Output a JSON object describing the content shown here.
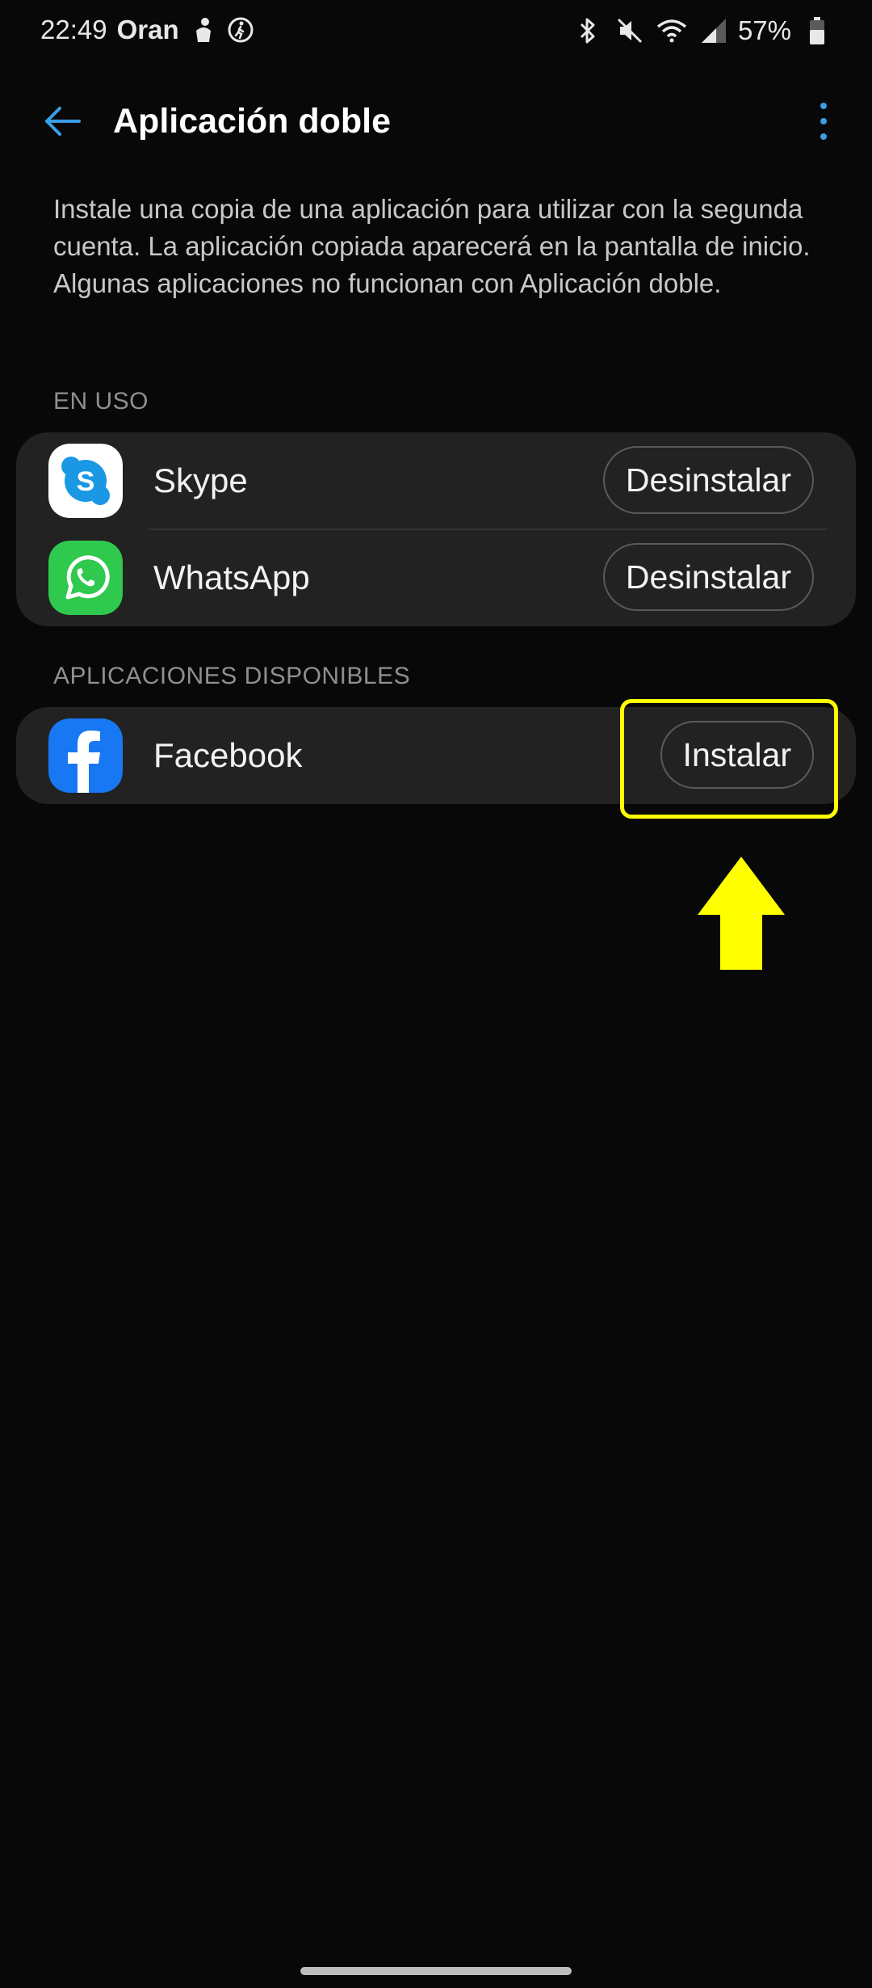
{
  "status_bar": {
    "time": "22:49",
    "carrier": "Oran",
    "battery_percent": "57%",
    "icons": [
      "emoji-status-icon",
      "activity-icon",
      "bluetooth-icon",
      "mute-icon",
      "wifi-icon",
      "signal-icon",
      "battery-icon"
    ]
  },
  "header": {
    "title": "Aplicación doble",
    "back_icon": "arrow-left-icon",
    "more_icon": "more-vert-icon"
  },
  "description": "Instale una copia de una aplicación para utilizar con la segunda cuenta. La aplicación copiada aparecerá en la pantalla de inicio. Algunas aplicaciones no funcionan con Aplicación doble.",
  "sections": {
    "in_use": {
      "label": "EN USO",
      "items": [
        {
          "name": "Skype",
          "action": "Desinstalar",
          "icon": "skype-icon"
        },
        {
          "name": "WhatsApp",
          "action": "Desinstalar",
          "icon": "whatsapp-icon"
        }
      ]
    },
    "available": {
      "label": "APLICACIONES DISPONIBLES",
      "items": [
        {
          "name": "Facebook",
          "action": "Instalar",
          "icon": "facebook-icon"
        }
      ]
    }
  },
  "colors": {
    "background": "#080808",
    "card": "#222222",
    "accent": "#3a9ee8",
    "annotation": "#ffff00"
  }
}
